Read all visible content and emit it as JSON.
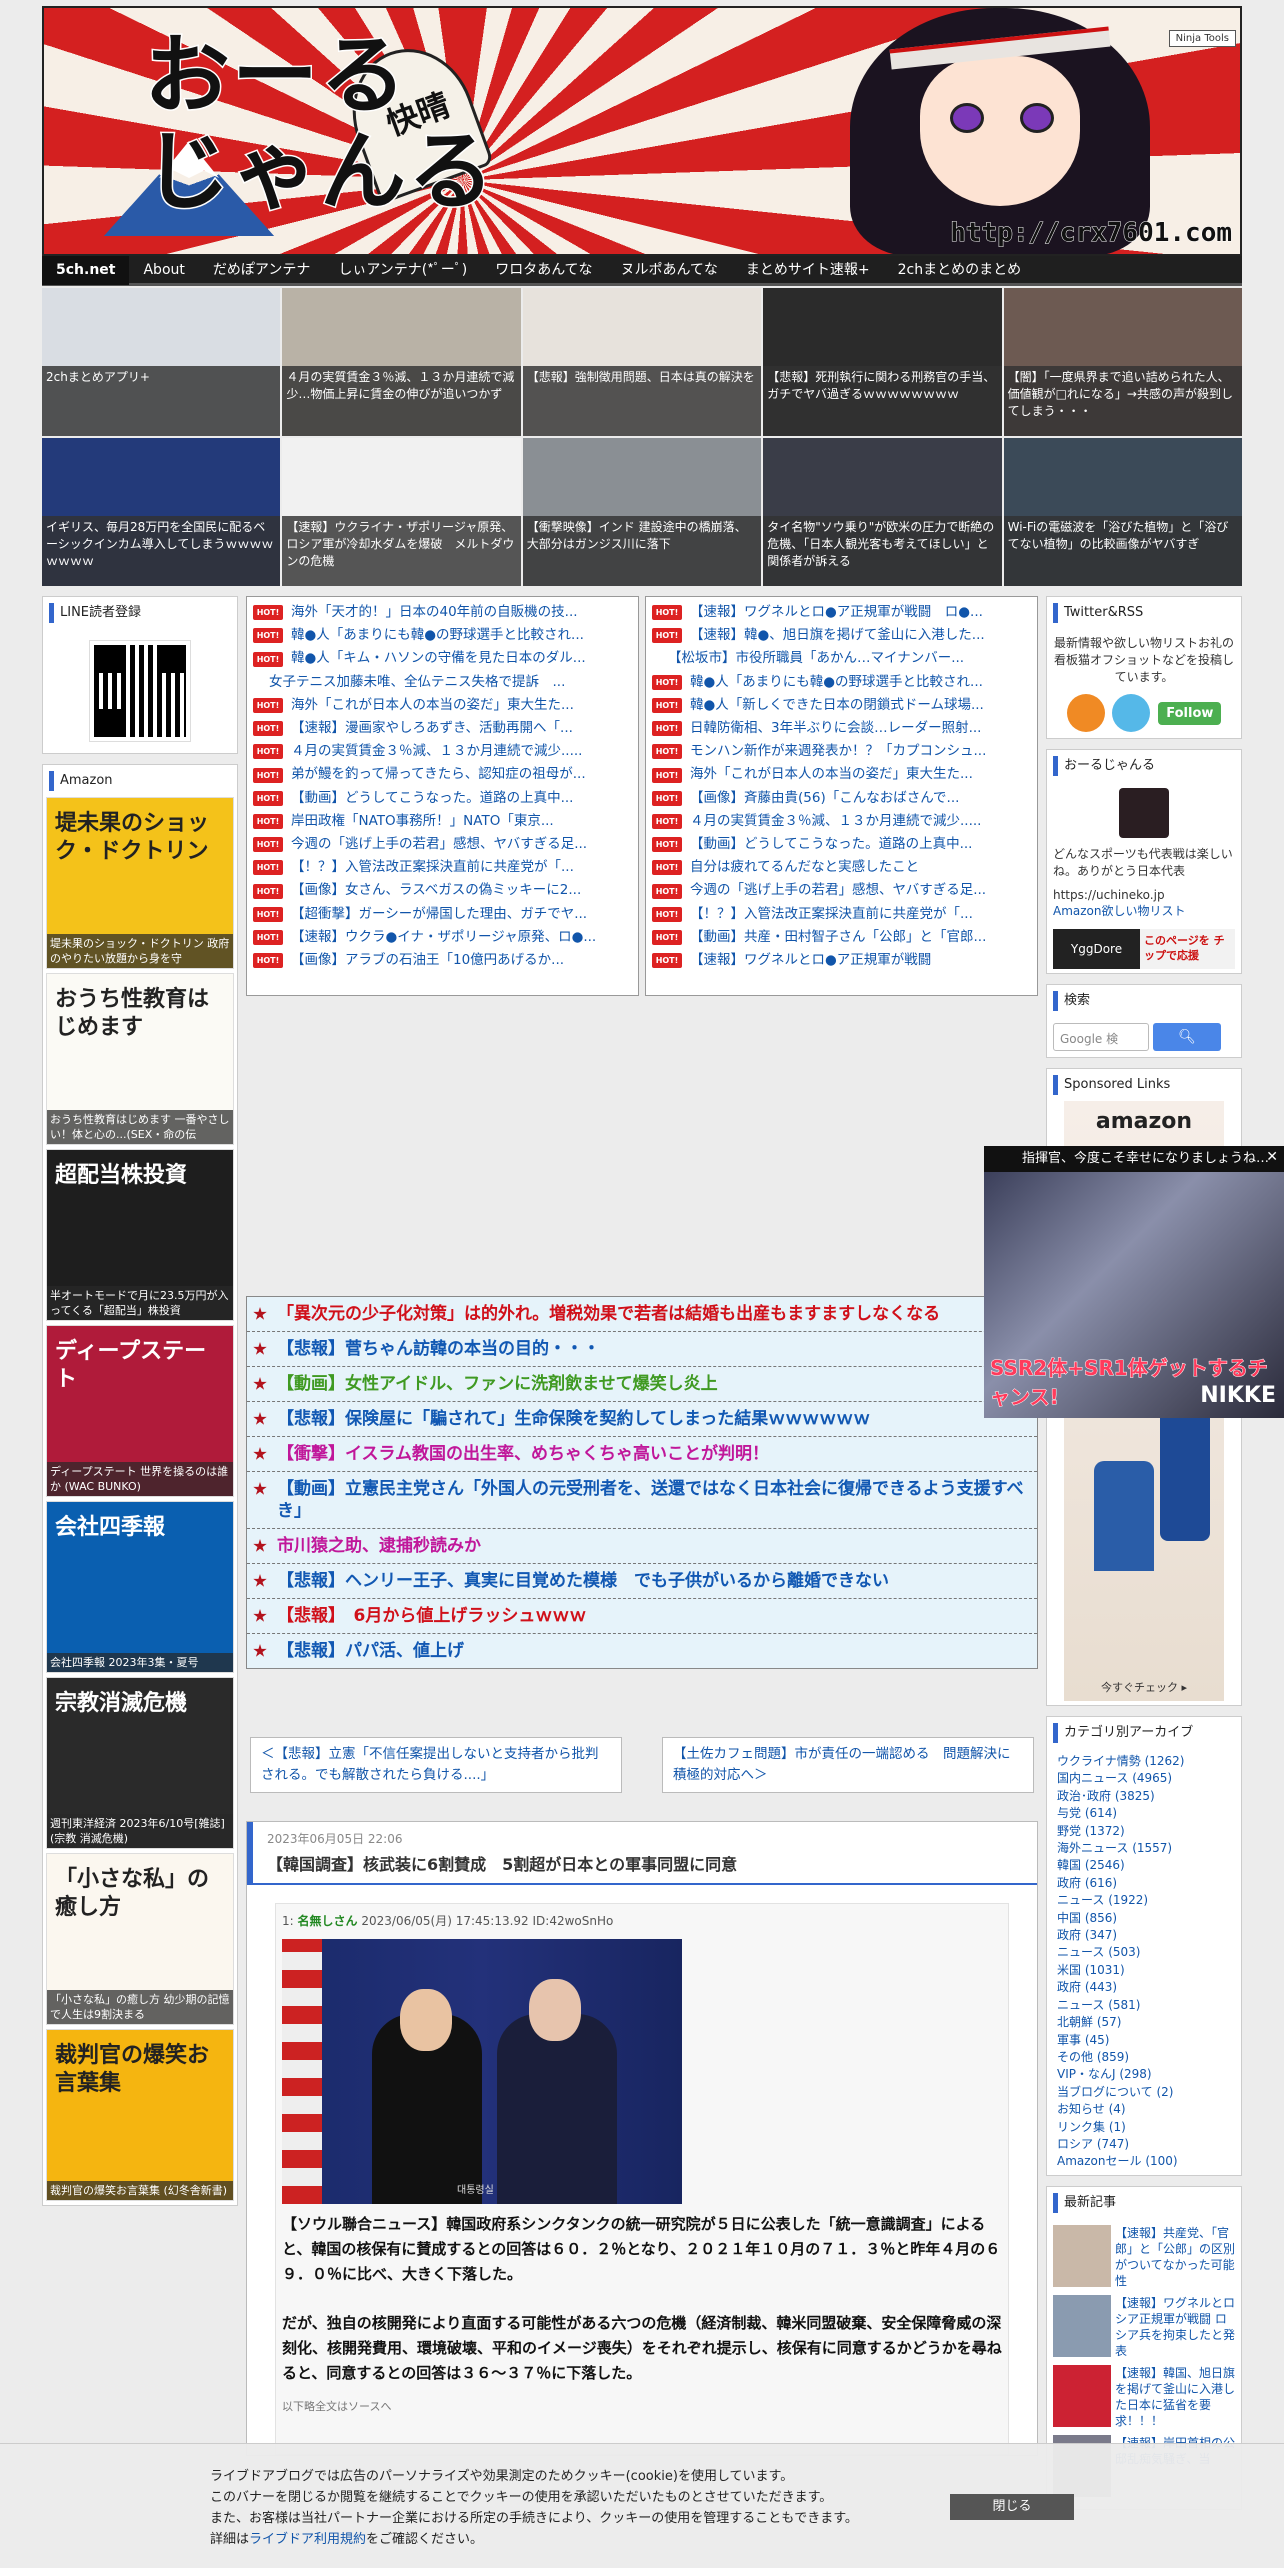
{
  "header": {
    "logo_text": "おーる\nじゃんる",
    "ninja_tools": "Ninja Tools",
    "url": "http://crx7601.com",
    "fan_text": "快晴"
  },
  "nav": [
    "5ch.net",
    "About",
    "だめぽアンテナ",
    "しぃアンテナ(*ﾟーﾟ)",
    "ワロタあんてな",
    "ヌルポあんてな",
    "まとめサイト速報+",
    "2chまとめのまとめ"
  ],
  "thumbs": [
    {
      "caption": "2chまとめアプリ+",
      "color": "#d9dde3"
    },
    {
      "caption": "４月の実質賃金３％減、１３か月連続で減少…物価上昇に賃金の伸びが追いつかず",
      "color": "#b9b2a6"
    },
    {
      "caption": "【悲報】強制徴用問題、日本は真の解決を",
      "color": "#e7e2dc"
    },
    {
      "caption": "【悲報】死刑執行に関わる刑務官の手当、ガチでヤバ過ぎるｗｗｗｗｗｗｗｗ",
      "color": "#2b2b2b"
    },
    {
      "caption": "【闇】「一度県界まで追い詰められた人、価値観が□れになる」→共感の声が殺到してしまう・・・",
      "color": "#6d5a52"
    },
    {
      "caption": "イギリス、毎月28万円を全国民に配るベーシックインカム導入してしまうｗｗｗｗｗｗｗｗ",
      "color": "#233a7a"
    },
    {
      "caption": "【速報】ウクライナ・ザポリージャ原発、ロシア軍が冷却水ダムを爆破　メルトダウンの危機",
      "color": "#f1f1f1"
    },
    {
      "caption": "【衝撃映像】インド 建設途中の橋崩落、大部分はガンジス川に落下",
      "color": "#8a8f94"
    },
    {
      "caption": "タイ名物\"ソウ乗り\"が欧米の圧力で断絶の危機、「日本人観光客も考えてほしい」と関係者が訴える",
      "color": "#3a3d48"
    },
    {
      "caption": "Wi-Fiの電磁波を「浴びた植物」と「浴びてない植物」の比較画像がヤバすぎ",
      "color": "#3b4a58"
    }
  ],
  "left": {
    "line_title": "LINE読者登録",
    "amazon_title": "Amazon",
    "books": [
      {
        "cover_text": "堤未果のショック・ドクトリン",
        "caption": "堤未果のショック・ドクトリン 政府のやりたい放題から身を守",
        "bg": "#f4c21a"
      },
      {
        "cover_text": "おうち性教育はじめます",
        "caption": "おうち性教育はじめます 一番やさしい！体と心の...(SEX・命の伝",
        "bg": "#fbfaf5"
      },
      {
        "cover_text": "超配当株投資",
        "caption": "半オートモードで月に23.5万円が入ってくる「超配当」株投資",
        "bg": "#1e1e1e"
      },
      {
        "cover_text": "ディープステート",
        "caption": "ディープステート 世界を操るのは誰か (WAC BUNKO)",
        "bg": "#b01b3a"
      },
      {
        "cover_text": "会社四季報",
        "caption": "会社四季報 2023年3集・夏号",
        "bg": "#0a5fb0"
      },
      {
        "cover_text": "宗教消滅危機",
        "caption": "週刊東洋経済 2023年6/10号[雑誌](宗教 消滅危機)",
        "bg": "#2a2a2a"
      },
      {
        "cover_text": "「小さな私」の癒し方",
        "caption": "「小さな私」の癒し方 幼少期の記憶で人生は9割決まる",
        "bg": "#fbf7ef"
      },
      {
        "cover_text": "裁判官の爆笑お言葉集",
        "caption": "裁判官の爆笑お言葉集 (幻冬舎新書)",
        "bg": "#f5b510"
      }
    ]
  },
  "rss_left": [
    {
      "text": "海外「天才的！」日本の40年前の自販機の技...",
      "hot": true,
      "pink": false
    },
    {
      "text": "韓●人「あまりにも韓●の野球選手と比較され...",
      "hot": true,
      "pink": false
    },
    {
      "text": "韓●人「キム・ハソンの守備を見た日本のダル...",
      "hot": true,
      "pink": false
    },
    {
      "text": "女子テニス加藤未唯、全仏テニス失格で提訴　...",
      "hot": false,
      "pink": false
    },
    {
      "text": "海外「これが日本人の本当の姿だ」東大生た...",
      "hot": true,
      "pink": false
    },
    {
      "text": "【速報】漫画家やしろあずき、活動再開へ「...",
      "hot": true,
      "pink": false
    },
    {
      "text": "４月の実質賃金３％減、１３か月連続で減少.....",
      "hot": true,
      "pink": false
    },
    {
      "text": "弟が鰻を釣って帰ってきたら、認知症の祖母が...",
      "hot": true,
      "pink": false
    },
    {
      "text": "【動画】どうしてこうなった。道路の上真中...",
      "hot": true,
      "pink": false
    },
    {
      "text": "岸田政権「NATO事務所！」NATO「東京...",
      "hot": true,
      "pink": false
    },
    {
      "text": "今週の「逃げ上手の若君」感想、ヤバすぎる足...",
      "hot": true,
      "pink": false
    },
    {
      "text": "【！？】入管法改正案採決直前に共産党が「...",
      "hot": true,
      "pink": false
    },
    {
      "text": "【画像】女さん、ラスベガスの偽ミッキーに2...",
      "hot": true,
      "pink": false
    },
    {
      "text": "【超衝撃】ガーシーが帰国した理由、ガチでヤ...",
      "hot": true,
      "pink": false
    },
    {
      "text": "【速報】ウクラ●イナ・ザポリージャ原発、ロ●...",
      "hot": true,
      "pink": false
    },
    {
      "text": "【画像】アラブの石油王「10億円あげるか...",
      "hot": true,
      "pink": false
    }
  ],
  "rss_right": [
    {
      "text": "【速報】ワグネルとロ●ア正規軍が戦闘　ロ●...",
      "hot": true,
      "pink": false
    },
    {
      "text": "【速報】韓●、旭日旗を掲げて釜山に入港した...",
      "hot": true,
      "pink": false
    },
    {
      "text": "【松坂市】市役所職員「あかん…マイナンバー...",
      "hot": false,
      "pink": false
    },
    {
      "text": "韓●人「あまりにも韓●の野球選手と比較され...",
      "hot": true,
      "pink": false
    },
    {
      "text": "韓●人「新しくできた日本の閉鎖式ドーム球場...",
      "hot": true,
      "pink": false
    },
    {
      "text": "日韓防衛相、3年半ぶりに会談…レーダー照射...",
      "hot": true,
      "pink": false
    },
    {
      "text": "モンハン新作が来週発表か！？「カプコンシュ...",
      "hot": true,
      "pink": false
    },
    {
      "text": "海外「これが日本人の本当の姿だ」東大生た...",
      "hot": true,
      "pink": false
    },
    {
      "text": "【画像】斉藤由貴(56)「こんなおばさんで...",
      "hot": true,
      "pink": false
    },
    {
      "text": "４月の実質賃金３％減、１３か月連続で減少.....",
      "hot": true,
      "pink": false
    },
    {
      "text": "【動画】どうしてこうなった。道路の上真中...",
      "hot": true,
      "pink": false
    },
    {
      "text": "自分は疲れてるんだなと実感したこと",
      "hot": true,
      "pink": false
    },
    {
      "text": "今週の「逃げ上手の若君」感想、ヤバすぎる足...",
      "hot": true,
      "pink": false
    },
    {
      "text": "【！？】入管法改正案採決直前に共産党が「...",
      "hot": true,
      "pink": false
    },
    {
      "text": "【動画】共産・田村智子さん「公郎」と「官郎...",
      "hot": true,
      "pink": false
    },
    {
      "text": "【速報】ワグネルとロ●ア正規軍が戦闘",
      "hot": true,
      "pink": false
    }
  ],
  "headlines": [
    {
      "text": "「異次元の少子化対策」は的外れ。増税効果で若者は結婚も出産もますますしなくなる",
      "color": "#d0101a"
    },
    {
      "text": "【悲報】菅ちゃん訪韓の本当の目的・・・",
      "color": "#1158b3"
    },
    {
      "text": "【動画】女性アイドル、ファンに洗剤飲ませて爆笑し炎上",
      "color": "#3f9a22"
    },
    {
      "text": "【悲報】保険屋に「騙されて」生命保険を契約してしまった結果ｗｗｗｗｗｗ",
      "color": "#1158b3"
    },
    {
      "text": "【衝撃】イスラム教国の出生率、めちゃくちゃ高いことが判明！",
      "color": "#c0179a"
    },
    {
      "text": "【動画】立憲民主党さん「外国人の元受刑者を、送還ではなく日本社会に復帰できるよう支援すべき」",
      "color": "#1158b3"
    },
    {
      "text": "市川猿之助、逮捕秒読みか",
      "color": "#c0179a"
    },
    {
      "text": "【悲報】ヘンリー王子、真実に目覚めた模様　でも子供がいるから離婚できない",
      "color": "#1158b3"
    },
    {
      "text": "【悲報】　6月から値上げラッシュｗｗｗ",
      "color": "#d0101a"
    },
    {
      "text": "【悲報】パパ活、値上げ",
      "color": "#1158b3"
    }
  ],
  "prev_next": {
    "prev": "＜【悲報】立憲「不信任案提出しないと支持者から批判される。でも解散されたら負ける....」",
    "next": "【土佐カフェ問題】市が責任の一端認める　問題解決に積極的対応へ＞"
  },
  "article": {
    "date": "2023年06月05日 22:06",
    "title": "【韓国調査】核武装に6割賛成　5割超が日本との軍事同盟に同意",
    "meta_num": "1:",
    "meta_name": "名無しさん",
    "meta_rest": " 2023/06/05(月) 17:45:13.92 ID:42woSnHo",
    "photo_watermark": "대통령실",
    "para1": "【ソウル聯合ニュース】韓国政府系シンクタンクの統一研究院が５日に公表した「統一意識調査」によると、韓国の核保有に賛成するとの回答は６０．２％となり、２０２１年１０月の７１．３％と昨年４月の６９．０％に比べ、大きく下落した。",
    "para2": "だが、独自の核開発により直面する可能性がある六つの危機（経済制裁、韓米同盟破棄、安全保障脅威の深刻化、核開発費用、環境破壊、平和のイメージ喪失）をそれぞれ提示し、核保有に同意するかどうかを尋ねると、同意するとの回答は３６～３７％に下落した。",
    "more": "以下略全文はソースへ"
  },
  "right": {
    "twitter_title": "Twitter&RSS",
    "twitter_desc": "最新情報や欲しい物リストお礼の看板猫オフショットなどを投稿しています。",
    "follow": "Follow",
    "profile_title": "おーるじゃんる",
    "profile_desc": "どんなスポーツも代表戦は楽しいね。ありがとう日本代表",
    "profile_url": "https://uchineko.jp",
    "wishlist": "Amazon欲しい物リスト",
    "yggdore": "YggDore",
    "yggdore_tip": "このページを チップで応援",
    "search_title": "検索",
    "search_placeholder": "Google 検",
    "sponsored_title": "Sponsored Links",
    "sponsored_amazon": "amazon",
    "sponsored_check": "今すぐチェック ▸",
    "category_title": "カテゴリ別アーカイブ",
    "categories": [
      "ウクライナ情勢 (1262)",
      "国内ニュース (4965)",
      "政治･政府 (3825)",
      "与党 (614)",
      "野党 (1372)",
      "海外ニュース (1557)",
      "韓国 (2546)",
      "政府 (616)",
      "ニュース (1922)",
      "中国 (856)",
      "政府 (347)",
      "ニュース (503)",
      "米国 (1031)",
      "政府 (443)",
      "ニュース (581)",
      "北朝鮮 (57)",
      "軍事 (45)",
      "その他 (859)",
      "VIP・なんJ (298)",
      "当ブログについて (2)",
      "お知らせ (4)",
      "リンク集 (1)",
      "ロシア (747)",
      "Amazonセール (100)"
    ],
    "recent_title": "最新記事",
    "recent": [
      "【速報】共産党、「官郎」と「公郎」の区別がついてなかった可能性",
      "【速報】ワグネルとロシア正規軍が戦闘 ロシア兵を拘束したと発表",
      "【速報】韓国、旭日旗を掲げて釜山に入港した日本に猛省を要求！！！",
      "【速報】岸田首相の公邸乱痴気騒ぎ、当"
    ]
  },
  "floatad": {
    "top": "指揮官、今度こそ幸せになりましょうね…",
    "ssr": "SSR2体+SR1体ゲットするチャンス!",
    "brand": "NIKKE"
  },
  "cookie": {
    "line1": "ライブドアブログでは広告のパーソナライズや効果測定のためクッキー(cookie)を使用しています。",
    "line2": "このバナーを閉じるか閲覧を継続することでクッキーの使用を承認いただいたものとさせていただきます。",
    "line3": "また、お客様は当社パートナー企業における所定の手続きにより、クッキーの使用を管理することもできます。",
    "line4_pre": "詳細は",
    "line4_link": "ライブドア利用規約",
    "line4_post": "をご確認ください。",
    "close": "閉じる"
  }
}
